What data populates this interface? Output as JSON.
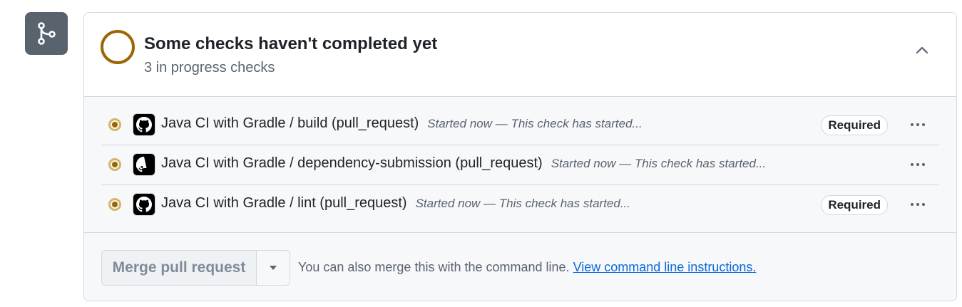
{
  "header": {
    "title": "Some checks haven't completed yet",
    "subtitle": "3 in progress checks"
  },
  "checks": [
    {
      "name": "Java CI with Gradle / build (pull_request)",
      "status": "Started now — This check has started...",
      "badge": "Required"
    },
    {
      "name": "Java CI with Gradle / dependency-submission (pull_request)",
      "status": "Started now — This check has started...",
      "badge": ""
    },
    {
      "name": "Java CI with Gradle / lint (pull_request)",
      "status": "Started now — This check has started...",
      "badge": "Required"
    }
  ],
  "footer": {
    "merge_label": "Merge pull request",
    "info_text": "You can also merge this with the command line.",
    "link_text": "View command line instructions."
  },
  "icons": {
    "merge": "git-merge-icon",
    "status": "in-progress-ring-icon",
    "collapse": "chevron-up-icon",
    "check_status": "pending-dot-icon",
    "avatar": "github-actions-icon",
    "more": "kebab-horizontal-icon",
    "dropdown": "triangle-down-icon"
  },
  "colors": {
    "pending": "#9a6700",
    "link": "#0969da",
    "muted": "#59636e",
    "border": "#d1d9e0"
  }
}
